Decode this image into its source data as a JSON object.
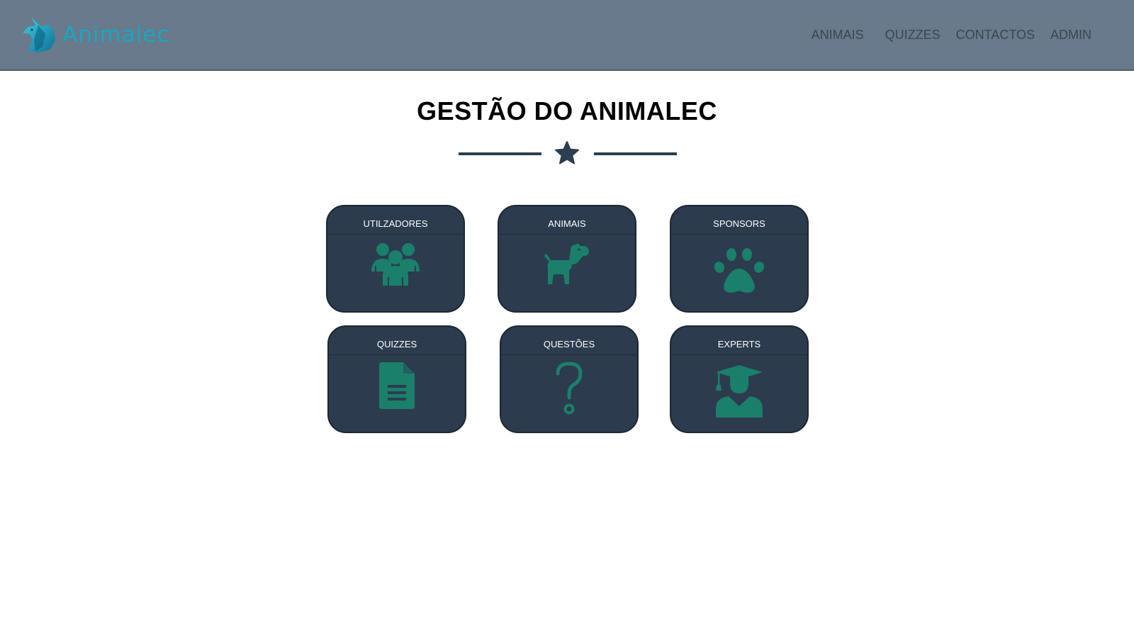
{
  "brand": {
    "name": "Animalec",
    "logo_icon": "fox-logo-icon",
    "color": "#17a8c4"
  },
  "nav": {
    "items": [
      {
        "label": "ANIMAIS"
      },
      {
        "label": "QUIZZES"
      },
      {
        "label": "CONTACTOS"
      },
      {
        "label": "ADMIN"
      }
    ]
  },
  "header": {
    "background": "#687a8b"
  },
  "page": {
    "title": "GESTÃO DO ANIMALEC",
    "divider_icon": "star-icon"
  },
  "cards": [
    {
      "label": "UTILZADORES",
      "icon": "users-icon"
    },
    {
      "label": "ANIMAIS",
      "icon": "dog-icon"
    },
    {
      "label": "SPONSORS",
      "icon": "paw-icon"
    },
    {
      "label": "QUIZZES",
      "icon": "file-text-icon"
    },
    {
      "label": "QUESTÕES",
      "icon": "question-mark-icon"
    },
    {
      "label": "EXPERTS",
      "icon": "graduate-icon"
    }
  ],
  "colors": {
    "card_background": "#2c3b4e",
    "icon_color": "#1a7f6b",
    "accent_dark": "#2c3e50"
  }
}
